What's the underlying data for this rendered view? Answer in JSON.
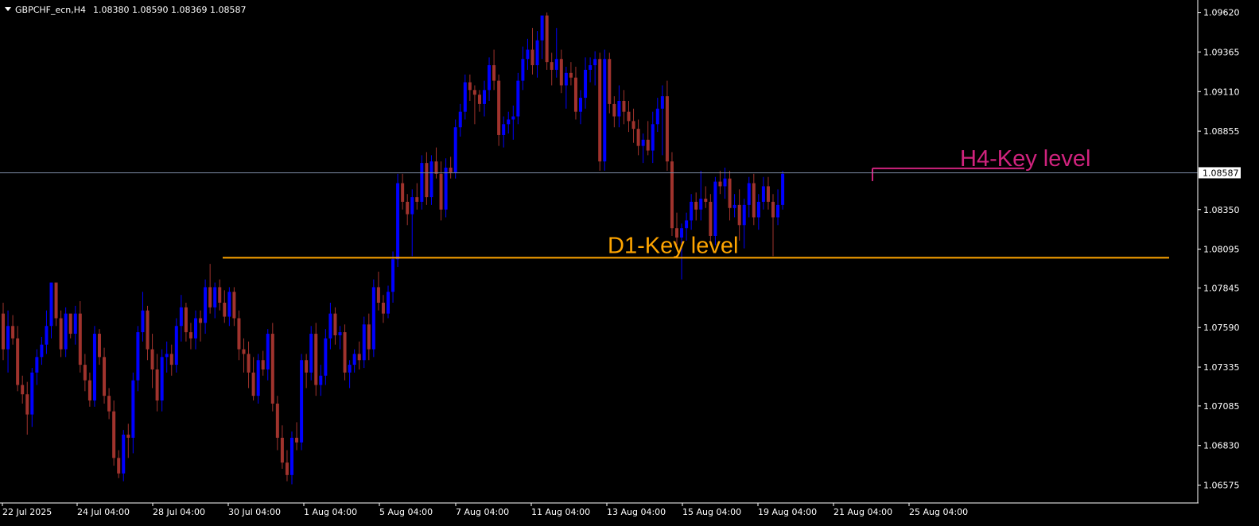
{
  "header": {
    "symbol": "GBPCHF_ecn,H4",
    "ohlc": "1.08380 1.08590 1.08369 1.08587"
  },
  "colors": {
    "bull": "#0000ff",
    "bear": "#a0332d",
    "axis": "#ffffff",
    "price_line": "#7f8da8",
    "d1_level": "#ffa500",
    "h4_level": "#d1237e",
    "price_tag_bg": "#ffffff",
    "price_tag_text": "#000000"
  },
  "chart_data": {
    "type": "candlestick",
    "ylim": [
      1.0646,
      1.097
    ],
    "y_ticks": [
      "1.09620",
      "1.09365",
      "1.09110",
      "1.08855",
      "1.08350",
      "1.08095",
      "1.07845",
      "1.07590",
      "1.07335",
      "1.07085",
      "1.06830",
      "1.06575"
    ],
    "x_ticks": [
      "22 Jul 2025",
      "24 Jul 04:00",
      "28 Jul 04:00",
      "30 Jul 04:00",
      "1 Aug 04:00",
      "5 Aug 04:00",
      "7 Aug 04:00",
      "11 Aug 04:00",
      "13 Aug 04:00",
      "15 Aug 04:00",
      "19 Aug 04:00",
      "21 Aug 04:00",
      "25 Aug 04:00"
    ],
    "current_price": "1.08587",
    "candles": [
      [
        1.0768,
        1.0775,
        1.0738,
        1.0745
      ],
      [
        1.0745,
        1.077,
        1.073,
        1.076
      ],
      [
        1.076,
        1.0767,
        1.0748,
        1.0752
      ],
      [
        1.0752,
        1.076,
        1.0718,
        1.0722
      ],
      [
        1.0722,
        1.0728,
        1.071,
        1.0716
      ],
      [
        1.0716,
        1.0724,
        1.069,
        1.0703
      ],
      [
        1.0703,
        1.0733,
        1.0695,
        1.073
      ],
      [
        1.073,
        1.0745,
        1.0722,
        1.074
      ],
      [
        1.074,
        1.0753,
        1.0735,
        1.0748
      ],
      [
        1.0748,
        1.077,
        1.0742,
        1.076
      ],
      [
        1.076,
        1.0782,
        1.0752,
        1.0788
      ],
      [
        1.0788,
        1.0782,
        1.076,
        1.0765
      ],
      [
        1.0765,
        1.077,
        1.074,
        1.0745
      ],
      [
        1.0745,
        1.0772,
        1.074,
        1.0768
      ],
      [
        1.0768,
        1.076,
        1.0752,
        1.0755
      ],
      [
        1.0755,
        1.0773,
        1.0748,
        1.0768
      ],
      [
        1.0768,
        1.0776,
        1.073,
        1.0735
      ],
      [
        1.0735,
        1.0742,
        1.0718,
        1.0725
      ],
      [
        1.0725,
        1.073,
        1.0708,
        1.0712
      ],
      [
        1.0712,
        1.076,
        1.0708,
        1.0755
      ],
      [
        1.0755,
        1.0758,
        1.0735,
        1.074
      ],
      [
        1.074,
        1.0746,
        1.071,
        1.0715
      ],
      [
        1.0715,
        1.072,
        1.07,
        1.0705
      ],
      [
        1.0705,
        1.0712,
        1.067,
        1.0675
      ],
      [
        1.0675,
        1.068,
        1.0662,
        1.0665
      ],
      [
        1.0665,
        1.0693,
        1.066,
        1.069
      ],
      [
        1.069,
        1.0697,
        1.0675,
        1.0688
      ],
      [
        1.0688,
        1.073,
        1.0678,
        1.0725
      ],
      [
        1.0725,
        1.076,
        1.0718,
        1.0756
      ],
      [
        1.0756,
        1.0782,
        1.075,
        1.077
      ],
      [
        1.077,
        1.0773,
        1.0738,
        1.0745
      ],
      [
        1.0745,
        1.0755,
        1.072,
        1.0732
      ],
      [
        1.0732,
        1.0742,
        1.0705,
        1.0712
      ],
      [
        1.0712,
        1.0745,
        1.0705,
        1.074
      ],
      [
        1.074,
        1.075,
        1.073,
        1.0742
      ],
      [
        1.0742,
        1.0748,
        1.0728,
        1.0735
      ],
      [
        1.0735,
        1.0765,
        1.073,
        1.076
      ],
      [
        1.076,
        1.078,
        1.075,
        1.0772
      ],
      [
        1.0772,
        1.0775,
        1.075,
        1.0756
      ],
      [
        1.0756,
        1.0762,
        1.0745,
        1.0752
      ],
      [
        1.0752,
        1.077,
        1.0745,
        1.0765
      ],
      [
        1.0765,
        1.077,
        1.075,
        1.0762
      ],
      [
        1.0762,
        1.079,
        1.0755,
        1.0785
      ],
      [
        1.0785,
        1.08,
        1.0768,
        1.0772
      ],
      [
        1.0772,
        1.0788,
        1.0765,
        1.0785
      ],
      [
        1.0785,
        1.079,
        1.077,
        1.0775
      ],
      [
        1.0775,
        1.0783,
        1.0762,
        1.0766
      ],
      [
        1.0766,
        1.0785,
        1.076,
        1.0782
      ],
      [
        1.0782,
        1.0785,
        1.076,
        1.0765
      ],
      [
        1.0765,
        1.077,
        1.0738,
        1.0745
      ],
      [
        1.0745,
        1.0752,
        1.073,
        1.0742
      ],
      [
        1.0742,
        1.075,
        1.072,
        1.073
      ],
      [
        1.073,
        1.074,
        1.0712,
        1.0715
      ],
      [
        1.0715,
        1.0742,
        1.071,
        1.0738
      ],
      [
        1.0738,
        1.0744,
        1.0728,
        1.0732
      ],
      [
        1.0732,
        1.0758,
        1.0725,
        1.0755
      ],
      [
        1.0755,
        1.0762,
        1.0705,
        1.071
      ],
      [
        1.071,
        1.0715,
        1.068,
        1.0688
      ],
      [
        1.0688,
        1.0696,
        1.0668,
        1.0672
      ],
      [
        1.0672,
        1.068,
        1.066,
        1.0664
      ],
      [
        1.0664,
        1.0692,
        1.0658,
        1.0688
      ],
      [
        1.0688,
        1.0698,
        1.068,
        1.0685
      ],
      [
        1.0685,
        1.0742,
        1.068,
        1.0738
      ],
      [
        1.0738,
        1.0742,
        1.072,
        1.073
      ],
      [
        1.073,
        1.076,
        1.0725,
        1.0755
      ],
      [
        1.0755,
        1.0762,
        1.0715,
        1.0722
      ],
      [
        1.0722,
        1.0735,
        1.0715,
        1.0728
      ],
      [
        1.0728,
        1.0758,
        1.0722,
        1.0752
      ],
      [
        1.0752,
        1.0775,
        1.0745,
        1.0768
      ],
      [
        1.0768,
        1.0772,
        1.0748,
        1.0754
      ],
      [
        1.0754,
        1.076,
        1.0745,
        1.0756
      ],
      [
        1.0756,
        1.0761,
        1.0725,
        1.073
      ],
      [
        1.073,
        1.0738,
        1.072,
        1.0735
      ],
      [
        1.0735,
        1.0745,
        1.073,
        1.0742
      ],
      [
        1.0742,
        1.075,
        1.0732,
        1.0738
      ],
      [
        1.0738,
        1.0766,
        1.0733,
        1.0761
      ],
      [
        1.0761,
        1.0768,
        1.0738,
        1.0745
      ],
      [
        1.0745,
        1.079,
        1.074,
        1.0785
      ],
      [
        1.0785,
        1.0795,
        1.077,
        1.0775
      ],
      [
        1.0775,
        1.078,
        1.0762,
        1.0768
      ],
      [
        1.0768,
        1.0786,
        1.0765,
        1.0782
      ],
      [
        1.0782,
        1.0808,
        1.0775,
        1.0803
      ],
      [
        1.0803,
        1.0858,
        1.0798,
        1.0852
      ],
      [
        1.0852,
        1.0858,
        1.0835,
        1.084
      ],
      [
        1.084,
        1.0845,
        1.0825,
        1.0832
      ],
      [
        1.0832,
        1.0848,
        1.0805,
        1.0843
      ],
      [
        1.0843,
        1.0852,
        1.0835,
        1.084
      ],
      [
        1.084,
        1.087,
        1.0835,
        1.0865
      ],
      [
        1.0865,
        1.0872,
        1.0838,
        1.0843
      ],
      [
        1.0843,
        1.087,
        1.0838,
        1.0866
      ],
      [
        1.0866,
        1.0875,
        1.0855,
        1.0858
      ],
      [
        1.0858,
        1.0866,
        1.0828,
        1.0835
      ],
      [
        1.0835,
        1.0868,
        1.083,
        1.0862
      ],
      [
        1.0862,
        1.0869,
        1.0855,
        1.0859
      ],
      [
        1.0859,
        1.0893,
        1.0855,
        1.0888
      ],
      [
        1.0888,
        1.0903,
        1.0882,
        1.0898
      ],
      [
        1.0898,
        1.0922,
        1.0893,
        1.0917
      ],
      [
        1.0917,
        1.0922,
        1.0905,
        1.0912
      ],
      [
        1.0912,
        1.0915,
        1.089,
        1.0909
      ],
      [
        1.0909,
        1.0912,
        1.0898,
        1.0903
      ],
      [
        1.0903,
        1.0918,
        1.0895,
        1.0912
      ],
      [
        1.0912,
        1.0933,
        1.0905,
        1.0928
      ],
      [
        1.0928,
        1.0938,
        1.0912,
        1.0918
      ],
      [
        1.0918,
        1.0922,
        1.0876,
        1.0883
      ],
      [
        1.0883,
        1.0895,
        1.0875,
        1.089
      ],
      [
        1.089,
        1.0898,
        1.0884,
        1.0893
      ],
      [
        1.0893,
        1.0902,
        1.088,
        1.0895
      ],
      [
        1.0895,
        1.0923,
        1.089,
        1.0918
      ],
      [
        1.0918,
        1.094,
        1.0912,
        1.0932
      ],
      [
        1.0932,
        1.0945,
        1.0925,
        1.0938
      ],
      [
        1.0938,
        1.0952,
        1.0922,
        1.0928
      ],
      [
        1.0928,
        1.095,
        1.092,
        1.0944
      ],
      [
        1.0944,
        1.0958,
        1.0932,
        1.096
      ],
      [
        1.096,
        1.0962,
        1.0925,
        1.093
      ],
      [
        1.093,
        1.0936,
        1.0915,
        1.0925
      ],
      [
        1.0925,
        1.0952,
        1.092,
        1.0932
      ],
      [
        1.0932,
        1.0938,
        1.091,
        1.0915
      ],
      [
        1.0915,
        1.0927,
        1.09,
        1.0923
      ],
      [
        1.0923,
        1.093,
        1.0915,
        1.092
      ],
      [
        1.092,
        1.0927,
        1.0893,
        1.0898
      ],
      [
        1.0898,
        1.0912,
        1.089,
        1.0907
      ],
      [
        1.0907,
        1.0933,
        1.09,
        1.0925
      ],
      [
        1.0925,
        1.0933,
        1.0917,
        1.0928
      ],
      [
        1.0928,
        1.0937,
        1.0915,
        1.0932
      ],
      [
        1.0932,
        1.0936,
        1.086,
        1.0866
      ],
      [
        1.0866,
        1.0938,
        1.086,
        1.0932
      ],
      [
        1.0932,
        1.0936,
        1.0897,
        1.0903
      ],
      [
        1.0903,
        1.0908,
        1.0888,
        1.0895
      ],
      [
        1.0895,
        1.0915,
        1.0888,
        1.0905
      ],
      [
        1.0905,
        1.0912,
        1.089,
        1.0898
      ],
      [
        1.0898,
        1.0905,
        1.0885,
        1.0892
      ],
      [
        1.0892,
        1.09,
        1.0878,
        1.0887
      ],
      [
        1.0887,
        1.0893,
        1.087,
        1.0876
      ],
      [
        1.0876,
        1.0884,
        1.0865,
        1.088
      ],
      [
        1.088,
        1.0892,
        1.087,
        1.0873
      ],
      [
        1.0873,
        1.0898,
        1.0865,
        1.089
      ],
      [
        1.089,
        1.0907,
        1.0885,
        1.09
      ],
      [
        1.09,
        1.0915,
        1.087,
        1.0908
      ],
      [
        1.0908,
        1.0918,
        1.086,
        1.0866
      ],
      [
        1.0866,
        1.0872,
        1.0818,
        1.0823
      ],
      [
        1.0823,
        1.0833,
        1.0812,
        1.0817
      ],
      [
        1.0817,
        1.0826,
        1.079,
        1.0823
      ],
      [
        1.0823,
        1.0833,
        1.0815,
        1.0828
      ],
      [
        1.0828,
        1.0845,
        1.0822,
        1.084
      ],
      [
        1.084,
        1.0846,
        1.0828,
        1.0835
      ],
      [
        1.0835,
        1.086,
        1.0828,
        1.0842
      ],
      [
        1.0842,
        1.085,
        1.0836,
        1.084
      ],
      [
        1.084,
        1.0845,
        1.0812,
        1.0818
      ],
      [
        1.0818,
        1.0856,
        1.0812,
        1.0853
      ],
      [
        1.0853,
        1.086,
        1.0845,
        1.085
      ],
      [
        1.085,
        1.0862,
        1.0842,
        1.0855
      ],
      [
        1.0855,
        1.086,
        1.0828,
        1.0836
      ],
      [
        1.0836,
        1.0845,
        1.083,
        1.0838
      ],
      [
        1.0838,
        1.0848,
        1.0815,
        1.0825
      ],
      [
        1.0825,
        1.0842,
        1.081,
        1.0838
      ],
      [
        1.0838,
        1.0856,
        1.083,
        1.0852
      ],
      [
        1.0852,
        1.0858,
        1.0825,
        1.083
      ],
      [
        1.083,
        1.0845,
        1.0822,
        1.084
      ],
      [
        1.084,
        1.0856,
        1.0835,
        1.085
      ],
      [
        1.085,
        1.0856,
        1.0835,
        1.084
      ],
      [
        1.084,
        1.0845,
        1.0805,
        1.083
      ],
      [
        1.083,
        1.0848,
        1.0825,
        1.0838
      ],
      [
        1.0838,
        1.086,
        1.0835,
        1.0858
      ]
    ],
    "levels": [
      {
        "label": "D1-Key level",
        "price": 1.0804
      },
      {
        "label": "H4-Key level",
        "price": 1.0859
      }
    ]
  }
}
